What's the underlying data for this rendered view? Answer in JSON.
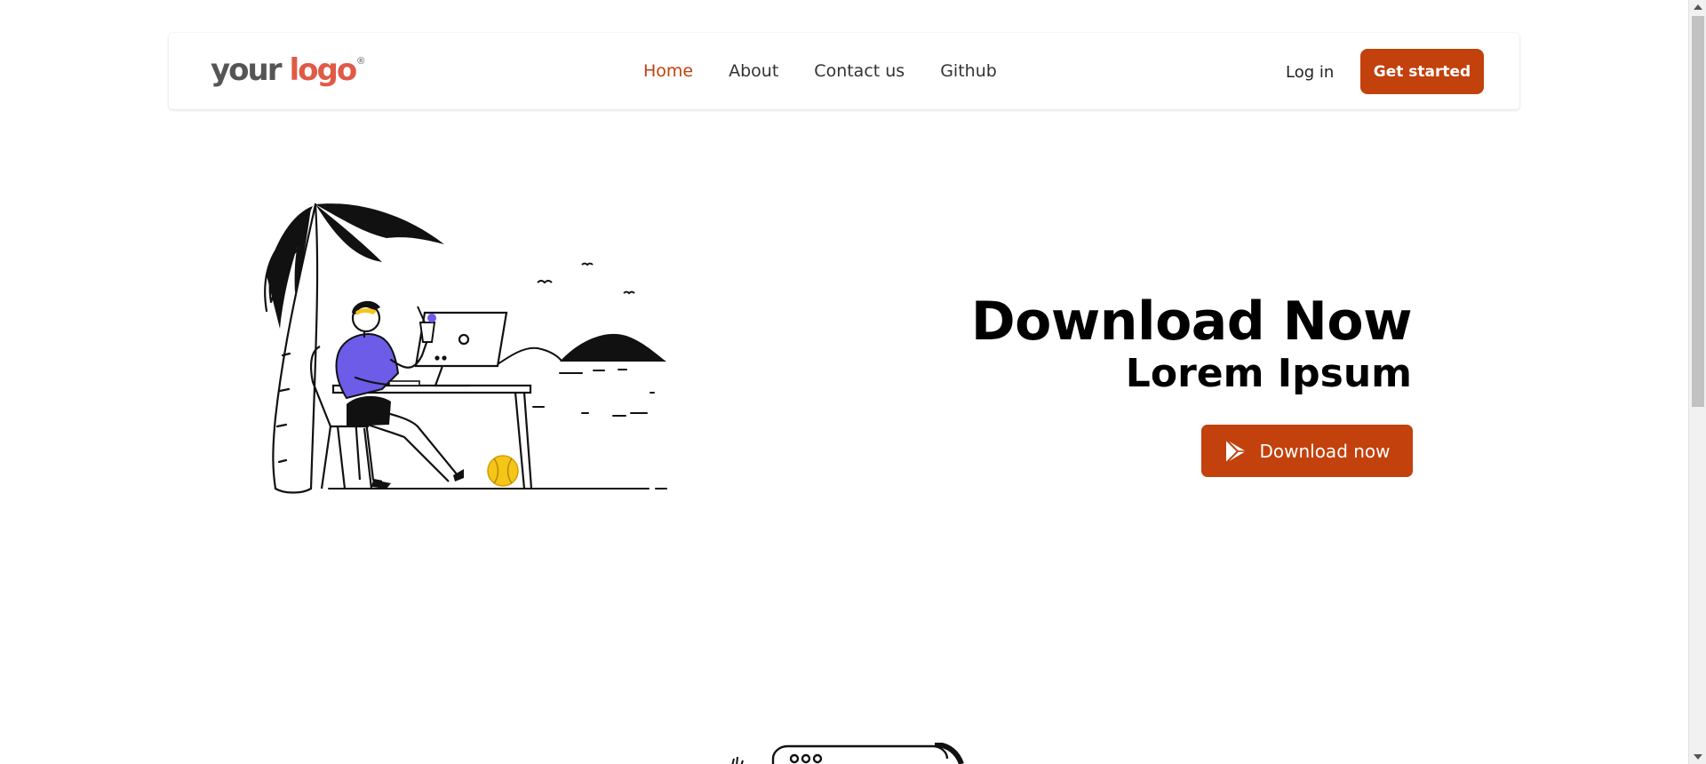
{
  "header": {
    "logo": {
      "word1": "your",
      "word2": "logo",
      "registered": "®"
    },
    "nav": [
      {
        "label": "Home",
        "active": true
      },
      {
        "label": "About",
        "active": false
      },
      {
        "label": "Contact us",
        "active": false
      },
      {
        "label": "Github",
        "active": false
      }
    ],
    "login_label": "Log in",
    "cta_label": "Get started"
  },
  "hero": {
    "title": "Download Now",
    "subtitle": "Lorem Ipsum",
    "download_label": "Download now",
    "illustration": "person-working-on-beach-illustration"
  },
  "icons": {
    "download_button_icon": "play-store-icon"
  },
  "colors": {
    "accent": "#c2410c",
    "logo_accent": "#e05a47",
    "logo_text": "#555555",
    "shirt": "#6c5ce7",
    "ball": "#f5c518"
  }
}
